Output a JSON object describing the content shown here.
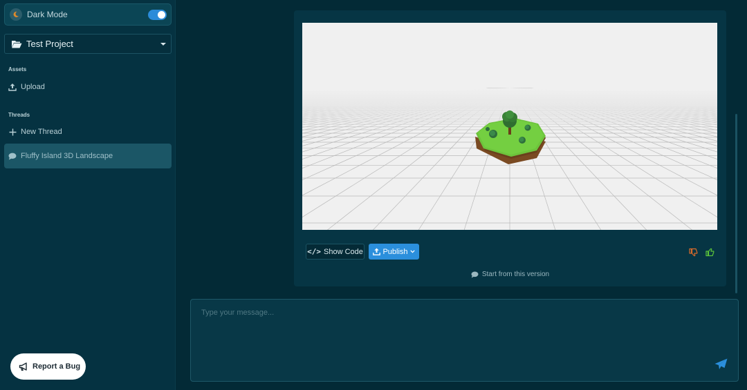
{
  "sidebar": {
    "dark_mode_label": "Dark Mode",
    "dark_mode_on": true,
    "project_label": "Test Project",
    "assets_title": "Assets",
    "upload_label": "Upload",
    "threads_title": "Threads",
    "new_thread_label": "New Thread",
    "threads": [
      {
        "label": "Fluffy Island 3D Landscape",
        "active": true
      }
    ],
    "report_bug_label": "Report a Bug"
  },
  "message": {
    "show_code_label": "Show Code",
    "publish_label": "Publish",
    "start_version_label": "Start from this version"
  },
  "composer": {
    "placeholder": "Type your message..."
  },
  "colors": {
    "accent": "#2b8fdc",
    "thumb_down": "#d96b2b",
    "thumb_up": "#5cc43a",
    "background": "#032a36"
  },
  "icons": {
    "theme": "moon-icon",
    "project": "folder-open-icon",
    "upload": "upload-icon",
    "new_thread": "plus-icon",
    "thread": "chat-bubble-icon",
    "report": "megaphone-icon",
    "show_code": "code-icon",
    "publish": "upload-icon",
    "send": "paper-plane-icon"
  }
}
